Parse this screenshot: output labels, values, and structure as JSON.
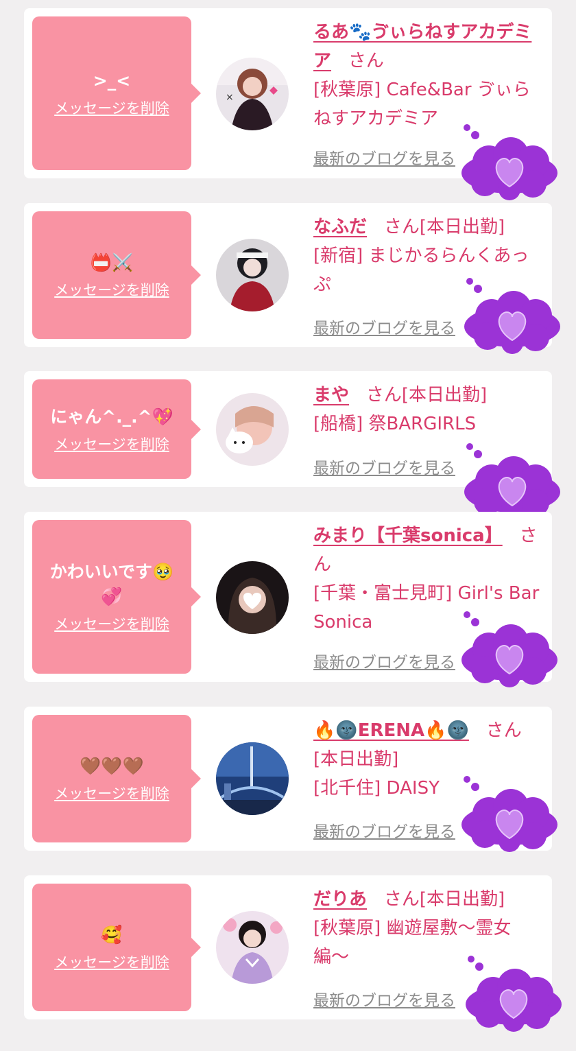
{
  "colors": {
    "bubble": "#f993a3",
    "accent": "#d93b6b",
    "cloud": "#9b33d6",
    "heart": "#c986ef"
  },
  "cards": [
    {
      "message": ">_<",
      "delete_label": "メッセージを削除",
      "name": "るあ🐾ゔぃらねすアカデミア",
      "honorific": "さん",
      "status": "",
      "shop": "[秋葉原] Cafe&Bar ゔぃらねすアカデミア",
      "blog_link": "最新のブログを見る",
      "reaction_icon": "purple-heart-cloud"
    },
    {
      "message": "📛⚔️",
      "delete_label": "メッセージを削除",
      "name": "なふだ",
      "honorific": "さん",
      "status": "[本日出勤]",
      "shop": "[新宿] まじかるらんくあっぷ",
      "blog_link": "最新のブログを見る",
      "reaction_icon": "purple-heart-cloud"
    },
    {
      "message": "にゃん^._.^💖",
      "delete_label": "メッセージを削除",
      "name": "まや",
      "honorific": "さん",
      "status": "[本日出勤]",
      "shop": "[船橋] 祭BARGIRLS",
      "blog_link": "最新のブログを見る",
      "reaction_icon": "purple-heart-cloud"
    },
    {
      "message": "かわいいです🥹💞",
      "delete_label": "メッセージを削除",
      "name": "みまり【千葉sonica】",
      "honorific": "さん",
      "status": "",
      "shop": "[千葉・富士見町] Girl's Bar Sonica",
      "blog_link": "最新のブログを見る",
      "reaction_icon": "purple-heart-cloud"
    },
    {
      "message": "🤎🤎🤎",
      "delete_label": "メッセージを削除",
      "name": "🔥🌚ERENA🔥🌚",
      "honorific": "さん",
      "status": "[本日出勤]",
      "shop": "[北千住] DAISY",
      "blog_link": "最新のブログを見る",
      "reaction_icon": "purple-heart-cloud"
    },
    {
      "message": "🥰",
      "delete_label": "メッセージを削除",
      "name": "だりあ",
      "honorific": "さん",
      "status": "[本日出勤]",
      "shop": "[秋葉原] 幽遊屋敷〜霊女編〜",
      "blog_link": "最新のブログを見る",
      "reaction_icon": "purple-heart-cloud"
    }
  ]
}
